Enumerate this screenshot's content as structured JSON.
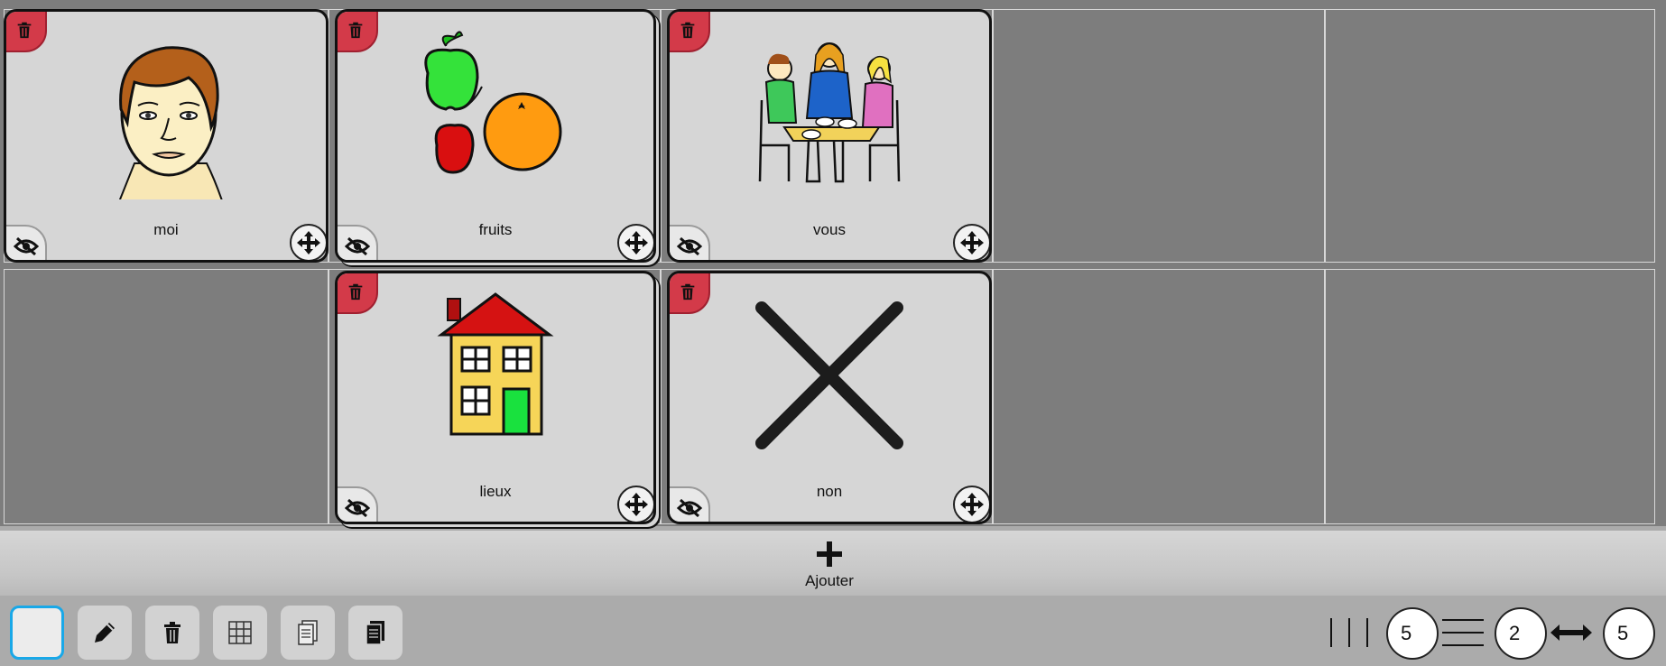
{
  "tiles": [
    {
      "label": "moi",
      "icon": "face-picto"
    },
    {
      "label": "fruits",
      "icon": "fruits-picto"
    },
    {
      "label": "vous",
      "icon": "people-at-table-picto"
    },
    {
      "label": "lieux",
      "icon": "house-picto"
    },
    {
      "label": "non",
      "icon": "cross-picto"
    }
  ],
  "add": {
    "label": "Ajouter"
  },
  "toolbar": {
    "buttons": [
      "blank-select-button",
      "edit-pencil-icon",
      "trash-icon",
      "grid-icon",
      "copy-page-icon",
      "paste-page-icon"
    ],
    "columns": "5",
    "rows": "2",
    "width": "5"
  },
  "colors": {
    "delete": "#d33a49",
    "selected_border": "#19a8e8",
    "grid": "#7d7d7d",
    "tile": "#d6d6d6"
  }
}
